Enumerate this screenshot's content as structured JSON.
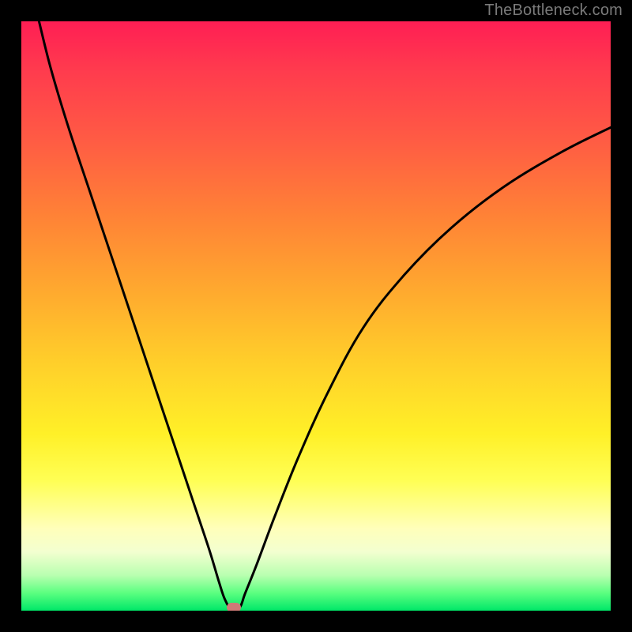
{
  "watermark": "TheBottleneck.com",
  "colors": {
    "page_bg": "#000000",
    "watermark": "#7a7a7a",
    "curve": "#000000",
    "marker": "#cf7a77",
    "gradient_top": "#ff1e54",
    "gradient_bottom": "#00e768"
  },
  "chart_data": {
    "type": "line",
    "title": "",
    "xlabel": "",
    "ylabel": "",
    "xlim": [
      0,
      100
    ],
    "ylim": [
      0,
      100
    ],
    "grid": false,
    "legend": false,
    "series": [
      {
        "name": "bottleneck-curve",
        "x": [
          3,
          5,
          8,
          12,
          16,
          20,
          24,
          28,
          30,
          32,
          33.5,
          34.5,
          35.5,
          37,
          38,
          40,
          43,
          47,
          52,
          58,
          65,
          73,
          82,
          92,
          100
        ],
        "y": [
          100,
          92,
          82,
          70,
          58,
          46,
          34,
          22,
          16,
          10,
          5,
          2,
          0.5,
          0.5,
          3,
          8,
          16,
          26,
          37,
          48,
          57,
          65,
          72,
          78,
          82
        ]
      }
    ],
    "marker": {
      "x": 36,
      "y": 0.5
    },
    "background_gradient": {
      "direction": "vertical",
      "stops": [
        {
          "pos": 0.0,
          "color": "#ff1e54"
        },
        {
          "pos": 0.2,
          "color": "#ff5b44"
        },
        {
          "pos": 0.45,
          "color": "#ffa72f"
        },
        {
          "pos": 0.7,
          "color": "#fff028"
        },
        {
          "pos": 0.86,
          "color": "#ffffba"
        },
        {
          "pos": 0.94,
          "color": "#b9ffb0"
        },
        {
          "pos": 1.0,
          "color": "#00e768"
        }
      ]
    }
  }
}
